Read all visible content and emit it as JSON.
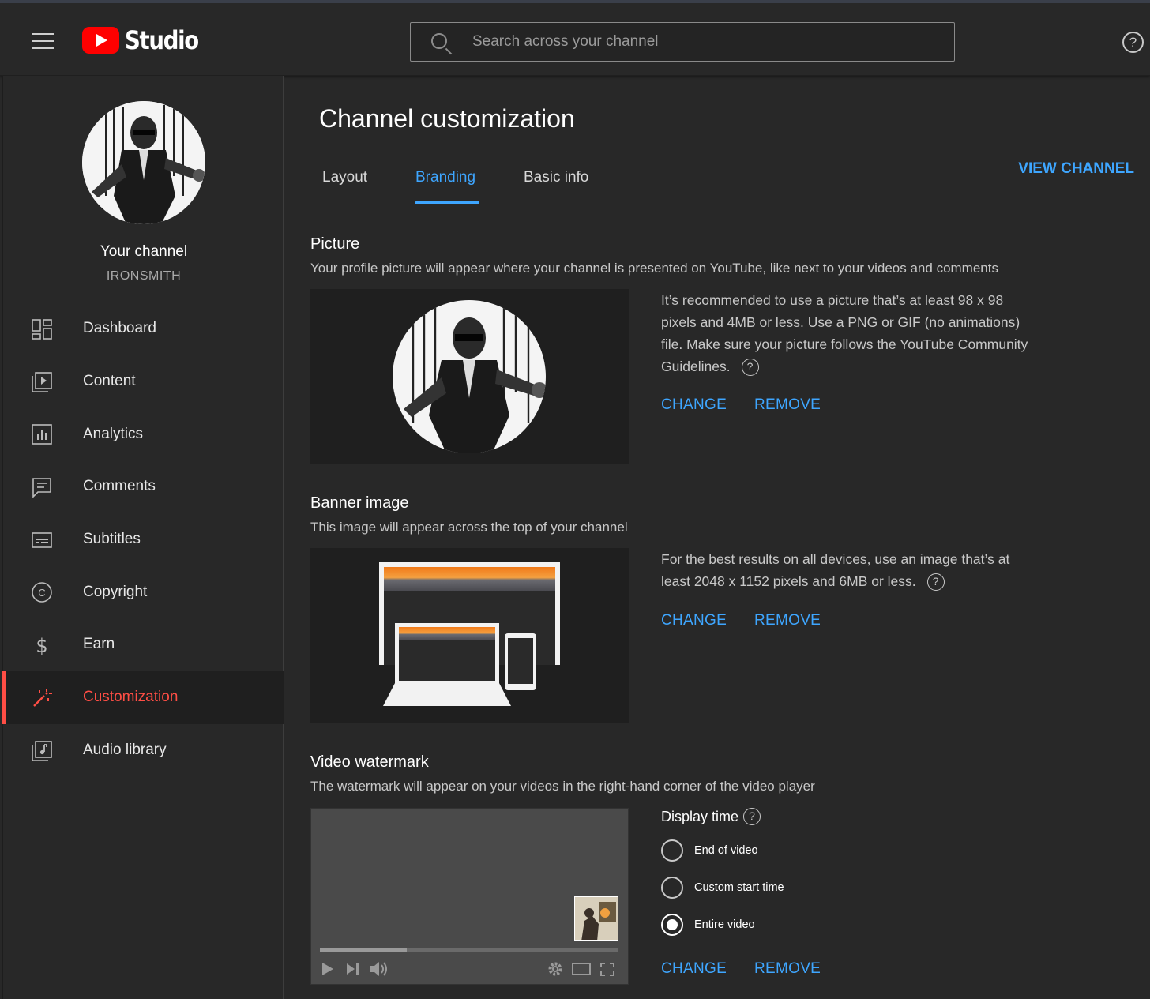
{
  "header": {
    "logo_text": "Studio",
    "search_placeholder": "Search across your channel",
    "help_label": "?"
  },
  "sidebar": {
    "channel_title": "Your channel",
    "channel_handle": "IRONSMITH",
    "items": [
      {
        "label": "Dashboard",
        "icon": "dashboard-icon"
      },
      {
        "label": "Content",
        "icon": "content-icon"
      },
      {
        "label": "Analytics",
        "icon": "analytics-icon"
      },
      {
        "label": "Comments",
        "icon": "comments-icon"
      },
      {
        "label": "Subtitles",
        "icon": "subtitles-icon"
      },
      {
        "label": "Copyright",
        "icon": "copyright-icon"
      },
      {
        "label": "Earn",
        "icon": "earn-icon"
      },
      {
        "label": "Customization",
        "icon": "customization-icon",
        "active": true
      },
      {
        "label": "Audio library",
        "icon": "audio-library-icon"
      }
    ]
  },
  "main": {
    "title": "Channel customization",
    "tabs": [
      {
        "label": "Layout"
      },
      {
        "label": "Branding",
        "active": true
      },
      {
        "label": "Basic info"
      }
    ],
    "view_channel": "VIEW CHANNEL",
    "picture": {
      "title": "Picture",
      "description": "Your profile picture will appear where your channel is presented on YouTube, like next to your videos and comments",
      "info": "It’s recommended to use a picture that’s at least 98 x 98 pixels and 4MB or less. Use a PNG or GIF (no animations) file. Make sure your picture follows the YouTube Community Guidelines.",
      "change": "CHANGE",
      "remove": "REMOVE"
    },
    "banner": {
      "title": "Banner image",
      "description": "This image will appear across the top of your channel",
      "info": "For the best results on all devices, use an image that’s at least 2048 x 1152 pixels and 6MB or less.",
      "change": "CHANGE",
      "remove": "REMOVE"
    },
    "watermark": {
      "title": "Video watermark",
      "description": "The watermark will appear on your videos in the right-hand corner of the video player",
      "display_time_label": "Display time",
      "options": [
        {
          "label": "End of video",
          "selected": false
        },
        {
          "label": "Custom start time",
          "selected": false
        },
        {
          "label": "Entire video",
          "selected": true
        }
      ],
      "change": "CHANGE",
      "remove": "REMOVE",
      "player_progress": 0.29
    }
  },
  "colors": {
    "accent": "#3ea6ff",
    "active_nav": "#ff4e45",
    "brand_red": "#ff0000",
    "background": "#282828"
  }
}
